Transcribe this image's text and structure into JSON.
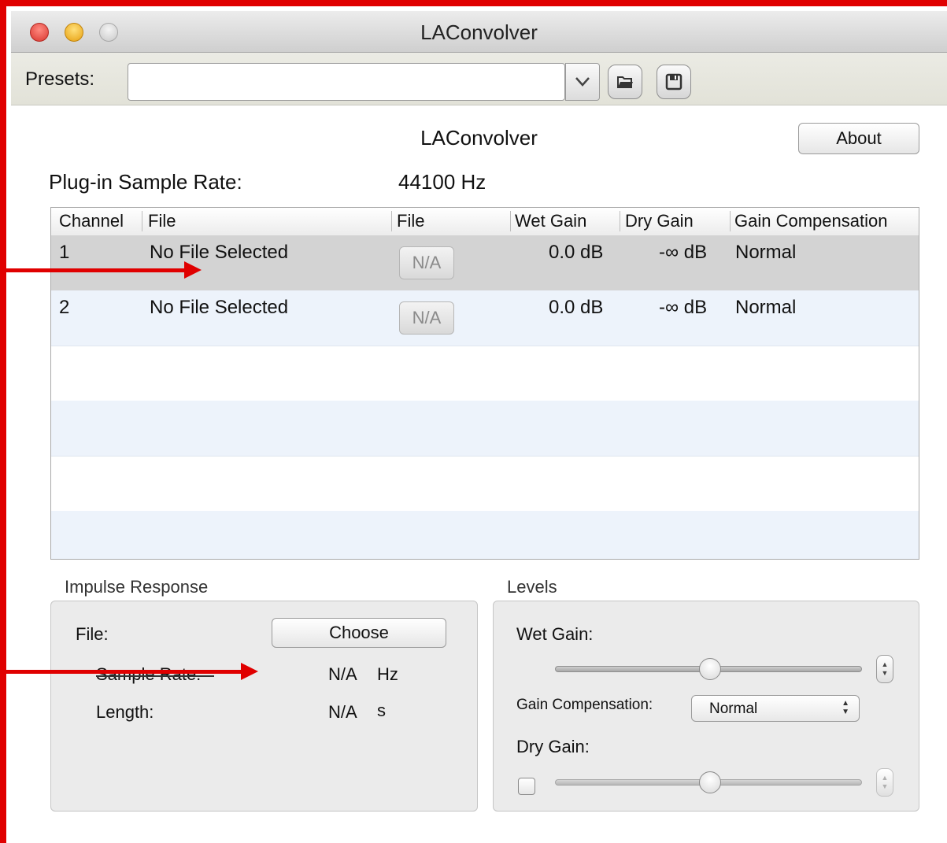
{
  "window": {
    "title": "LAConvolver"
  },
  "toolbar": {
    "presets_label": "Presets:",
    "preset_value": ""
  },
  "header": {
    "plugin_title": "LAConvolver",
    "about_label": "About",
    "sample_rate_label": "Plug-in Sample Rate:",
    "sample_rate_value": "44100 Hz"
  },
  "table": {
    "columns": [
      "Channel",
      "File",
      "File",
      "Wet Gain",
      "Dry Gain",
      "Gain Compensation"
    ],
    "rows": [
      {
        "channel": "1",
        "file": "No File Selected",
        "file_button": "N/A",
        "wet_gain": "0.0 dB",
        "dry_gain": "-∞ dB",
        "gain_comp": "Normal",
        "selected": true
      },
      {
        "channel": "2",
        "file": "No File Selected",
        "file_button": "N/A",
        "wet_gain": "0.0 dB",
        "dry_gain": "-∞ dB",
        "gain_comp": "Normal",
        "selected": false
      }
    ]
  },
  "impulse_response": {
    "group_label": "Impulse Response",
    "file_label": "File:",
    "choose_label": "Choose",
    "sample_rate_label": "Sample Rate:",
    "sample_rate_value": "N/A",
    "sample_rate_unit": "Hz",
    "length_label": "Length:",
    "length_value": "N/A",
    "length_unit": "s"
  },
  "levels": {
    "group_label": "Levels",
    "wet_gain_label": "Wet Gain:",
    "gain_comp_label": "Gain Compensation:",
    "gain_comp_value": "Normal",
    "dry_gain_label": "Dry Gain:"
  },
  "colors": {
    "annotation_red": "#e00000",
    "selected_row": "#d3d3d3",
    "alt_row": "#edf3fb"
  }
}
